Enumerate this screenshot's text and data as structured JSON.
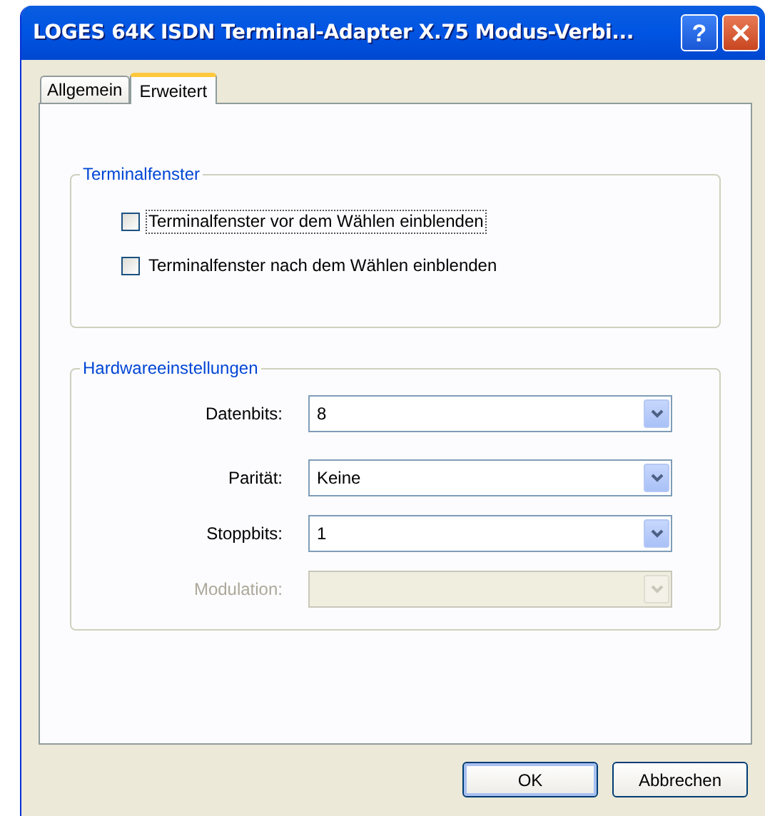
{
  "window": {
    "title": "LOGES 64K ISDN Terminal-Adapter X.75 Modus-Verbi..."
  },
  "title_buttons": [
    {
      "kind": "help",
      "label": "?"
    },
    {
      "kind": "close"
    }
  ],
  "tabs": [
    {
      "label": "Allgemein",
      "selected": false
    },
    {
      "label": "Erweitert",
      "selected": true
    }
  ],
  "terminal_group": {
    "title": "Terminalfenster",
    "options": [
      {
        "label": "Terminalfenster vor dem Wählen einblenden",
        "checked": false,
        "focused": true
      },
      {
        "label": "Terminalfenster nach dem Wählen einblenden",
        "checked": false,
        "focused": false
      }
    ]
  },
  "hardware_group": {
    "title": "Hardwareeinstellungen",
    "fields": [
      {
        "label": "Datenbits:",
        "value": "8",
        "disabled": false
      },
      {
        "label": "Parität:",
        "value": "Keine",
        "disabled": false
      },
      {
        "label": "Stoppbits:",
        "value": "1",
        "disabled": false
      },
      {
        "label": "Modulation:",
        "disabled": true
      }
    ]
  },
  "buttons": [
    {
      "label": "OK",
      "default": true
    },
    {
      "label": "Abbrechen",
      "default": false
    }
  ]
}
